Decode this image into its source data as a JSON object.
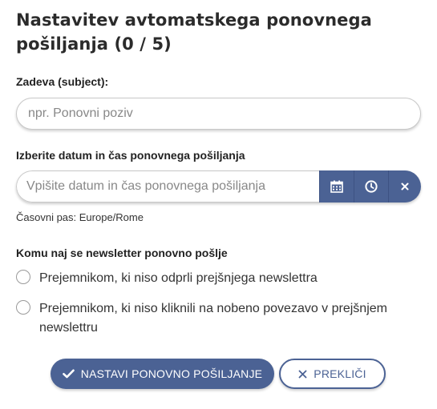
{
  "title": "Nastavitev avtomatskega ponovnega pošiljanja (0 / 5)",
  "subject": {
    "label": "Zadeva (subject):",
    "placeholder": "npr. Ponovni poziv"
  },
  "datetime": {
    "label": "Izberite datum in čas ponovnega pošiljanja",
    "placeholder": "Vpišite datum in čas ponovnega pošiljanja",
    "buttons": [
      "calendar-icon",
      "clock-icon",
      "clear-icon"
    ],
    "timezone": "Časovni pas: Europe/Rome"
  },
  "recipients": {
    "label": "Komu naj se newsletter ponovno pošlje",
    "options": [
      "Prejemnikom, ki niso odprli prejšnjega newslettra",
      "Prejemnikom, ki niso kliknili na nobeno povezavo v prejšnjem newslettru"
    ]
  },
  "actions": {
    "confirm_label": "NASTAVI PONOVNO POŠILJANJE",
    "cancel_label": "PREKLIČI"
  },
  "colors": {
    "accent": "#4b6294"
  }
}
